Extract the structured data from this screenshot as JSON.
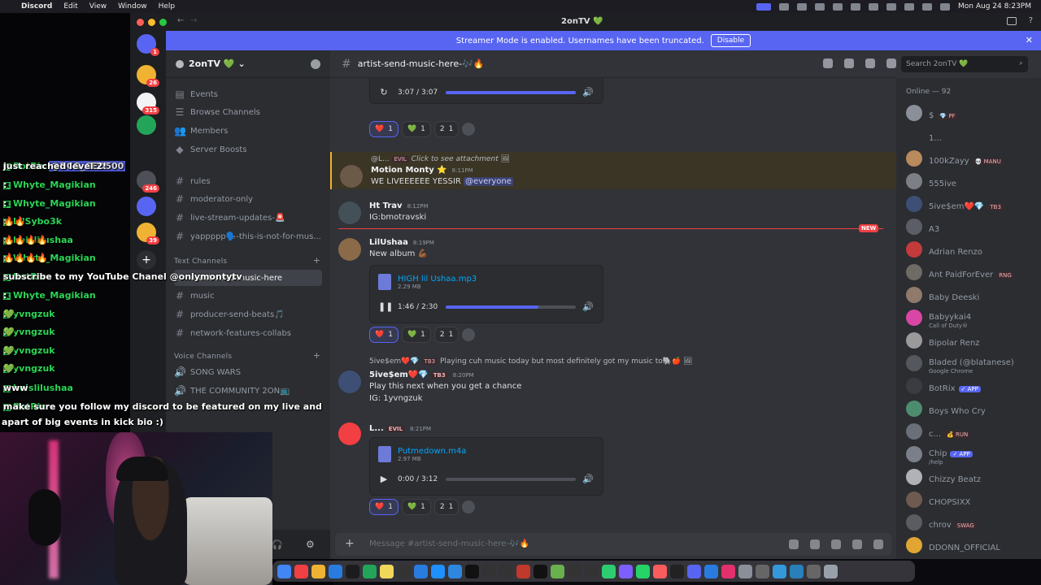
{
  "menubar": {
    "app": "Discord",
    "items": [
      "Edit",
      "View",
      "Window",
      "Help"
    ],
    "clock": "Mon Aug 24  8:23PM"
  },
  "stream_chat": [
    {
      "user": "BotRix",
      "text": ":",
      "mention": "@BCG_CEO500",
      "tail": "just reached level 2!"
    },
    {
      "user": "Whyte_Magikian",
      "text": ":",
      "mention": "",
      "tail": ""
    },
    {
      "user": "Whyte_Magikian",
      "text": ":",
      "mention": "",
      "tail": ""
    },
    {
      "user": "LilSybo3k",
      "text": ":",
      "mention": "",
      "tail": "🔥🔥"
    },
    {
      "user": "heislilushaa",
      "text": ":",
      "mention": "",
      "tail": "🔥🔥🔥🔥"
    },
    {
      "user": "Whyte_Magikian",
      "text": ":",
      "mention": "",
      "tail": "🔥🔥🔥🔥"
    },
    {
      "user": "BotRix",
      "text": ":",
      "mention": "",
      "tail": "subscribe to my YouTube Chanel @onlymontytv"
    },
    {
      "user": "Whyte_Magikian",
      "text": ":",
      "mention": "",
      "tail": ""
    },
    {
      "user": "yvngzuk",
      "text": ":",
      "mention": "",
      "tail": "💚"
    },
    {
      "user": "yvngzuk",
      "text": ":",
      "mention": "",
      "tail": "💚"
    },
    {
      "user": "yvngzuk",
      "text": ":",
      "mention": "",
      "tail": "💚"
    },
    {
      "user": "yvngzuk",
      "text": ":",
      "mention": "",
      "tail": "💚"
    },
    {
      "user": "heislilushaa",
      "text": ":",
      "mention": "",
      "tail": "www"
    },
    {
      "user": "BotRix",
      "text": ":",
      "mention": "",
      "tail": "make sure you follow my discord to be featured on my live and"
    }
  ],
  "stream_chat_wrap": "apart of big events in kick bio :)",
  "window": {
    "title": "2onTV 💚",
    "banner_text": "Streamer Mode is enabled. Usernames have been truncated.",
    "banner_button": "Disable"
  },
  "server_rail_badges": [
    "1",
    "26",
    "315",
    "246",
    "39"
  ],
  "sidebar": {
    "server_name": "2onTV 💚",
    "top_items": [
      "Events",
      "Browse Channels",
      "Members",
      "Server Boosts"
    ],
    "channels_top": [
      "rules",
      "moderator-only",
      "live-stream-updates-🚨",
      "yappppp🗣️-this-is-not-for-mus..."
    ],
    "text_category": "Text Channels",
    "text_channels": [
      "artist-send-music-here",
      "music",
      "producer-send-beats🎵",
      "network-features-collabs"
    ],
    "voice_category": "Voice Channels",
    "voice_channels": [
      "SONG WARS",
      "THE COMMUNITY 2ON📺"
    ]
  },
  "header": {
    "channel": "artist-send-music-here-🎶🔥",
    "search_placeholder": "Search 2onTV 💚"
  },
  "messages": {
    "audio1": {
      "time": "3:07 / 3:07",
      "progress": 1.0
    },
    "reactions": [
      {
        "emoji": "❤️",
        "count": "1"
      },
      {
        "emoji": "💚",
        "count": "1"
      },
      {
        "emoji": "2",
        "count": "1"
      }
    ],
    "m1": {
      "reply": "@L...",
      "reply_tag": "EVIL",
      "reply_text": "Click to see attachment",
      "author": "Motion Monty ⭐",
      "time": "8:11PM",
      "text": "WE LIVEEEEEE YESSIR",
      "mention": "@everyone"
    },
    "m2": {
      "author": "Ht Trav",
      "time": "8:12PM",
      "text": "IG:bmotravski"
    },
    "new_label": "NEW",
    "m3": {
      "author": "LilUshaa",
      "time": "8:19PM",
      "text": "New album 💪🏾",
      "file": "HIGH lil Ushaa.mp3",
      "size": "2.29 MB",
      "player_time": "1:46 / 2:30",
      "progress": 0.71
    },
    "m4": {
      "reply": "5ive$em❤️💎",
      "reply_tag": "TB3",
      "reply_text": "Playing cuh music today but most definitely got my music to🐘🍎",
      "author": "5ive$em❤️💎",
      "tag": "TB3",
      "time": "8:20PM",
      "text1": "Play this next when you get a chance",
      "text2": "IG: 1yvngzuk"
    },
    "m5": {
      "author": "L...",
      "tag": "EVIL",
      "time": "8:21PM",
      "file": "Putmedown.m4a",
      "size": "2.97 MB",
      "player_time": "0:00 / 3:12",
      "progress": 0.0
    }
  },
  "composer": {
    "placeholder": "Message #artist-send-music-here-🎶🔥"
  },
  "members": {
    "header": "Online — 92",
    "list": [
      {
        "name": "$",
        "tag": "💎 PF",
        "sub": "",
        "app": false,
        "color": "#8a8f99"
      },
      {
        "name": "1...",
        "tag": "",
        "sub": "",
        "app": false,
        "color": "#2b2d31"
      },
      {
        "name": "100kZayy",
        "tag": "💀 MANU",
        "sub": "",
        "app": false,
        "color": "#b98a5c"
      },
      {
        "name": "555ive",
        "tag": "",
        "sub": "",
        "app": false,
        "color": "#7d7f86"
      },
      {
        "name": "5ive$em❤️💎",
        "tag": "TB3",
        "sub": "",
        "app": false,
        "color": "#3d4f74"
      },
      {
        "name": "A3",
        "tag": "",
        "sub": "",
        "app": false,
        "color": "#5b5e66"
      },
      {
        "name": "Adrian Renzo",
        "tag": "",
        "sub": "",
        "app": false,
        "color": "#c23a3a"
      },
      {
        "name": "Ant PaidForEver",
        "tag": "RNG",
        "sub": "",
        "app": false,
        "color": "#6f6a64"
      },
      {
        "name": "Baby Deeski",
        "tag": "",
        "sub": "",
        "app": false,
        "color": "#8f7a6b"
      },
      {
        "name": "Babyykai4",
        "tag": "",
        "sub": "Call of Duty®",
        "app": false,
        "color": "#d946a6"
      },
      {
        "name": "Bipolar Renz",
        "tag": "",
        "sub": "",
        "app": false,
        "color": "#9a9a9a"
      },
      {
        "name": "Bladed (@blatanese)",
        "tag": "",
        "sub": "Google Chrome",
        "app": false,
        "color": "#55575e"
      },
      {
        "name": "BotRix",
        "tag": "✓ APP",
        "sub": "",
        "app": true,
        "color": "#3a3c42"
      },
      {
        "name": "Boys Who Cry",
        "tag": "",
        "sub": "",
        "app": false,
        "color": "#4d8c6f"
      },
      {
        "name": "c...",
        "tag": "💰 RUN",
        "sub": "",
        "app": false,
        "color": "#6b6f79"
      },
      {
        "name": "Chip",
        "tag": "✓ APP",
        "sub": "/help",
        "app": true,
        "color": "#7a7f8a"
      },
      {
        "name": "Chizzy Beatz",
        "tag": "",
        "sub": "",
        "app": false,
        "color": "#b0b2b8"
      },
      {
        "name": "CHOPSIXX",
        "tag": "",
        "sub": "",
        "app": false,
        "color": "#6f5a50"
      },
      {
        "name": "chrov",
        "tag": "SWAG",
        "sub": "",
        "app": false,
        "color": "#5a5c62"
      },
      {
        "name": "DDONN_OFFICIAL",
        "tag": "",
        "sub": "",
        "app": false,
        "color": "#e0a533"
      }
    ]
  }
}
